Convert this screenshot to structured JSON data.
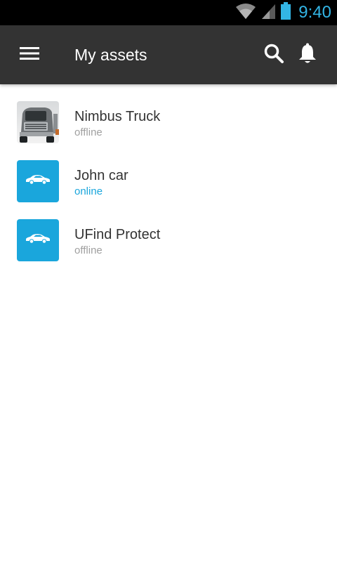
{
  "status_bar": {
    "time": "9:40",
    "icons": [
      "wifi-icon",
      "cell-signal-icon",
      "battery-icon"
    ],
    "time_color": "#33b5e5"
  },
  "app_bar": {
    "title": "My assets",
    "menu_icon": "hamburger-menu-icon",
    "search_icon": "search-icon",
    "notifications_icon": "bell-icon",
    "background": "#333333"
  },
  "assets": [
    {
      "name": "Nimbus Truck",
      "status": "offline",
      "icon": "truck-photo"
    },
    {
      "name": "John car",
      "status": "online",
      "icon": "car-icon"
    },
    {
      "name": "UFind Protect",
      "status": "offline",
      "icon": "car-icon"
    }
  ],
  "colors": {
    "accent": "#1aa6dc",
    "offline": "#a0a0a0"
  }
}
